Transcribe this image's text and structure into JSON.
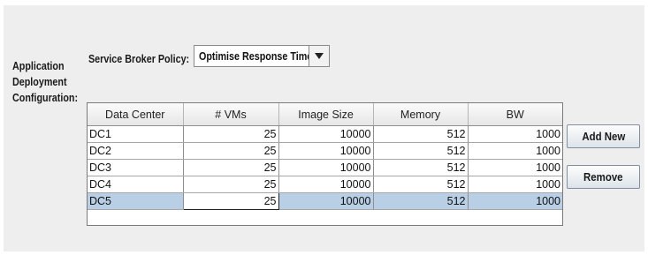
{
  "app_deployment": {
    "label_line1": "Application",
    "label_line2": "Deployment",
    "label_line3": "Configuration:"
  },
  "broker_policy": {
    "label": "Service Broker Policy:",
    "selected": "Optimise Response Time"
  },
  "table": {
    "columns": [
      "Data Center",
      "# VMs",
      "Image Size",
      "Memory",
      "BW"
    ],
    "rows": [
      [
        "DC1",
        "25",
        "10000",
        "512",
        "1000"
      ],
      [
        "DC2",
        "25",
        "10000",
        "512",
        "1000"
      ],
      [
        "DC3",
        "25",
        "10000",
        "512",
        "1000"
      ],
      [
        "DC4",
        "25",
        "10000",
        "512",
        "1000"
      ],
      [
        "DC5",
        "25",
        "10000",
        "512",
        "1000"
      ]
    ],
    "selected_row_index": 4,
    "editing_column_index": 1
  },
  "buttons": {
    "add_new": "Add New",
    "remove": "Remove"
  },
  "colors": {
    "panel_bg": "#eeeeee",
    "selection": "#b8cfe5"
  },
  "icons": {
    "dropdown": "triangle-down-icon"
  }
}
